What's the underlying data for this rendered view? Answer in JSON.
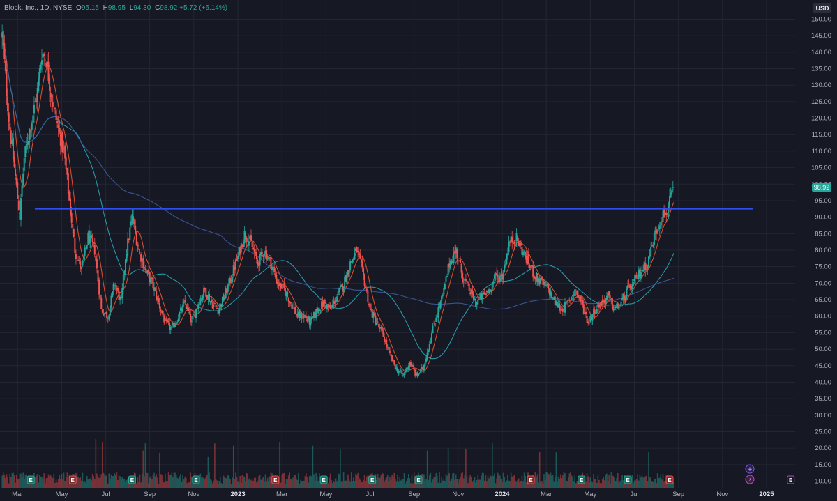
{
  "legend": {
    "symbol": "Block, Inc., 1D, NYSE",
    "open_label": "O",
    "open": "95.15",
    "high_label": "H",
    "high": "98.95",
    "low_label": "L",
    "low": "94.30",
    "close_label": "C",
    "close": "98.92",
    "change": "+5.72 (+6.14%)"
  },
  "currency": "USD",
  "last_price": "98.92",
  "colors": {
    "background": "#161823",
    "up": "#26a69a",
    "down": "#ef5350",
    "ma_fast": "#e8552e",
    "ma_mid": "#29a6b8",
    "ma_slow": "#3f5aa0",
    "resistance": "#2f4ff0",
    "grid": "#232633"
  },
  "icons": [
    "plus-circle-icon",
    "lightning-icon"
  ],
  "chart_data": {
    "type": "candlestick",
    "yscale": "linear",
    "grid": true,
    "ylim": [
      8,
      152
    ],
    "y_ticks": [
      "150.00",
      "145.00",
      "140.00",
      "135.00",
      "130.00",
      "125.00",
      "120.00",
      "115.00",
      "110.00",
      "105.00",
      "100.00",
      "95.00",
      "90.00",
      "85.00",
      "80.00",
      "75.00",
      "70.00",
      "65.00",
      "60.00",
      "55.00",
      "50.00",
      "45.00",
      "40.00",
      "35.00",
      "30.00",
      "25.00",
      "20.00",
      "15.00",
      "10.00"
    ],
    "x_ticks": [
      "Mar",
      "May",
      "Jul",
      "Sep",
      "Nov",
      "2023",
      "Mar",
      "May",
      "Jul",
      "Sep",
      "Nov",
      "2024",
      "Mar",
      "May",
      "Jul",
      "Sep",
      "Nov",
      "2025"
    ],
    "x_tick_months": [
      2,
      4,
      6,
      8,
      10,
      12,
      14,
      16,
      18,
      20,
      22,
      24,
      26,
      28,
      30,
      32,
      34,
      36
    ],
    "x_range_months": [
      1.2,
      37.3
    ],
    "price_anchors": [
      [
        1.3,
        145
      ],
      [
        1.6,
        120
      ],
      [
        1.9,
        102
      ],
      [
        2.1,
        90
      ],
      [
        2.3,
        108
      ],
      [
        2.6,
        118
      ],
      [
        2.9,
        128
      ],
      [
        3.1,
        140
      ],
      [
        3.3,
        138
      ],
      [
        3.5,
        128
      ],
      [
        3.8,
        118
      ],
      [
        4.1,
        110
      ],
      [
        4.3,
        98
      ],
      [
        4.6,
        80
      ],
      [
        4.9,
        74
      ],
      [
        5.2,
        84
      ],
      [
        5.5,
        80
      ],
      [
        5.8,
        62
      ],
      [
        6.1,
        60
      ],
      [
        6.4,
        70
      ],
      [
        6.7,
        64
      ],
      [
        6.9,
        78
      ],
      [
        7.2,
        90
      ],
      [
        7.5,
        80
      ],
      [
        7.8,
        74
      ],
      [
        8.1,
        70
      ],
      [
        8.4,
        64
      ],
      [
        8.7,
        58
      ],
      [
        9.0,
        56
      ],
      [
        9.3,
        60
      ],
      [
        9.6,
        64
      ],
      [
        9.9,
        58
      ],
      [
        10.2,
        64
      ],
      [
        10.5,
        68
      ],
      [
        10.8,
        64
      ],
      [
        11.1,
        62
      ],
      [
        11.4,
        66
      ],
      [
        11.7,
        72
      ],
      [
        12.0,
        78
      ],
      [
        12.3,
        85
      ],
      [
        12.6,
        82
      ],
      [
        12.9,
        76
      ],
      [
        13.2,
        80
      ],
      [
        13.5,
        76
      ],
      [
        13.8,
        70
      ],
      [
        14.1,
        68
      ],
      [
        14.4,
        64
      ],
      [
        14.7,
        60
      ],
      [
        15.0,
        60
      ],
      [
        15.3,
        58
      ],
      [
        15.6,
        62
      ],
      [
        15.9,
        64
      ],
      [
        16.2,
        62
      ],
      [
        16.5,
        66
      ],
      [
        16.8,
        70
      ],
      [
        17.1,
        76
      ],
      [
        17.4,
        80
      ],
      [
        17.7,
        72
      ],
      [
        18.0,
        62
      ],
      [
        18.3,
        58
      ],
      [
        18.6,
        54
      ],
      [
        18.9,
        48
      ],
      [
        19.2,
        44
      ],
      [
        19.5,
        42
      ],
      [
        19.8,
        46
      ],
      [
        20.1,
        42
      ],
      [
        20.4,
        44
      ],
      [
        20.7,
        52
      ],
      [
        21.0,
        60
      ],
      [
        21.3,
        66
      ],
      [
        21.6,
        76
      ],
      [
        21.9,
        80
      ],
      [
        22.2,
        72
      ],
      [
        22.5,
        68
      ],
      [
        22.8,
        64
      ],
      [
        23.1,
        66
      ],
      [
        23.4,
        68
      ],
      [
        23.7,
        72
      ],
      [
        24.0,
        72
      ],
      [
        24.3,
        82
      ],
      [
        24.6,
        84
      ],
      [
        24.9,
        80
      ],
      [
        25.2,
        76
      ],
      [
        25.5,
        72
      ],
      [
        25.8,
        70
      ],
      [
        26.1,
        68
      ],
      [
        26.4,
        64
      ],
      [
        26.7,
        62
      ],
      [
        27.0,
        64
      ],
      [
        27.3,
        68
      ],
      [
        27.6,
        64
      ],
      [
        27.9,
        58
      ],
      [
        28.2,
        62
      ],
      [
        28.5,
        64
      ],
      [
        28.8,
        66
      ],
      [
        29.1,
        62
      ],
      [
        29.4,
        64
      ],
      [
        29.7,
        68
      ],
      [
        30.0,
        70
      ],
      [
        30.3,
        74
      ],
      [
        30.6,
        76
      ],
      [
        30.9,
        84
      ],
      [
        31.2,
        90
      ],
      [
        31.5,
        92
      ],
      [
        31.8,
        98.92
      ]
    ],
    "resistance_price": 92.5,
    "moving_averages": [
      {
        "periods": 10,
        "color_key": "ma_fast"
      },
      {
        "periods": 50,
        "color_key": "ma_mid"
      },
      {
        "periods": 200,
        "color_key": "ma_slow"
      }
    ],
    "earnings_marks": [
      {
        "month": 2.6,
        "label": "E",
        "type": "up"
      },
      {
        "month": 4.5,
        "label": "E",
        "type": "down"
      },
      {
        "month": 7.2,
        "label": "E",
        "type": "up"
      },
      {
        "month": 10.1,
        "label": "E",
        "type": "up"
      },
      {
        "month": 13.7,
        "label": "E",
        "type": "down"
      },
      {
        "month": 15.9,
        "label": "E",
        "type": "up"
      },
      {
        "month": 18.1,
        "label": "E",
        "type": "up"
      },
      {
        "month": 20.2,
        "label": "E",
        "type": "up"
      },
      {
        "month": 25.3,
        "label": "E",
        "type": "down"
      },
      {
        "month": 27.6,
        "label": "E",
        "type": "up"
      },
      {
        "month": 29.7,
        "label": "E",
        "type": "up"
      },
      {
        "month": 31.6,
        "label": "E",
        "type": "down"
      },
      {
        "month": 37.1,
        "label": "E",
        "type": "future"
      }
    ]
  }
}
